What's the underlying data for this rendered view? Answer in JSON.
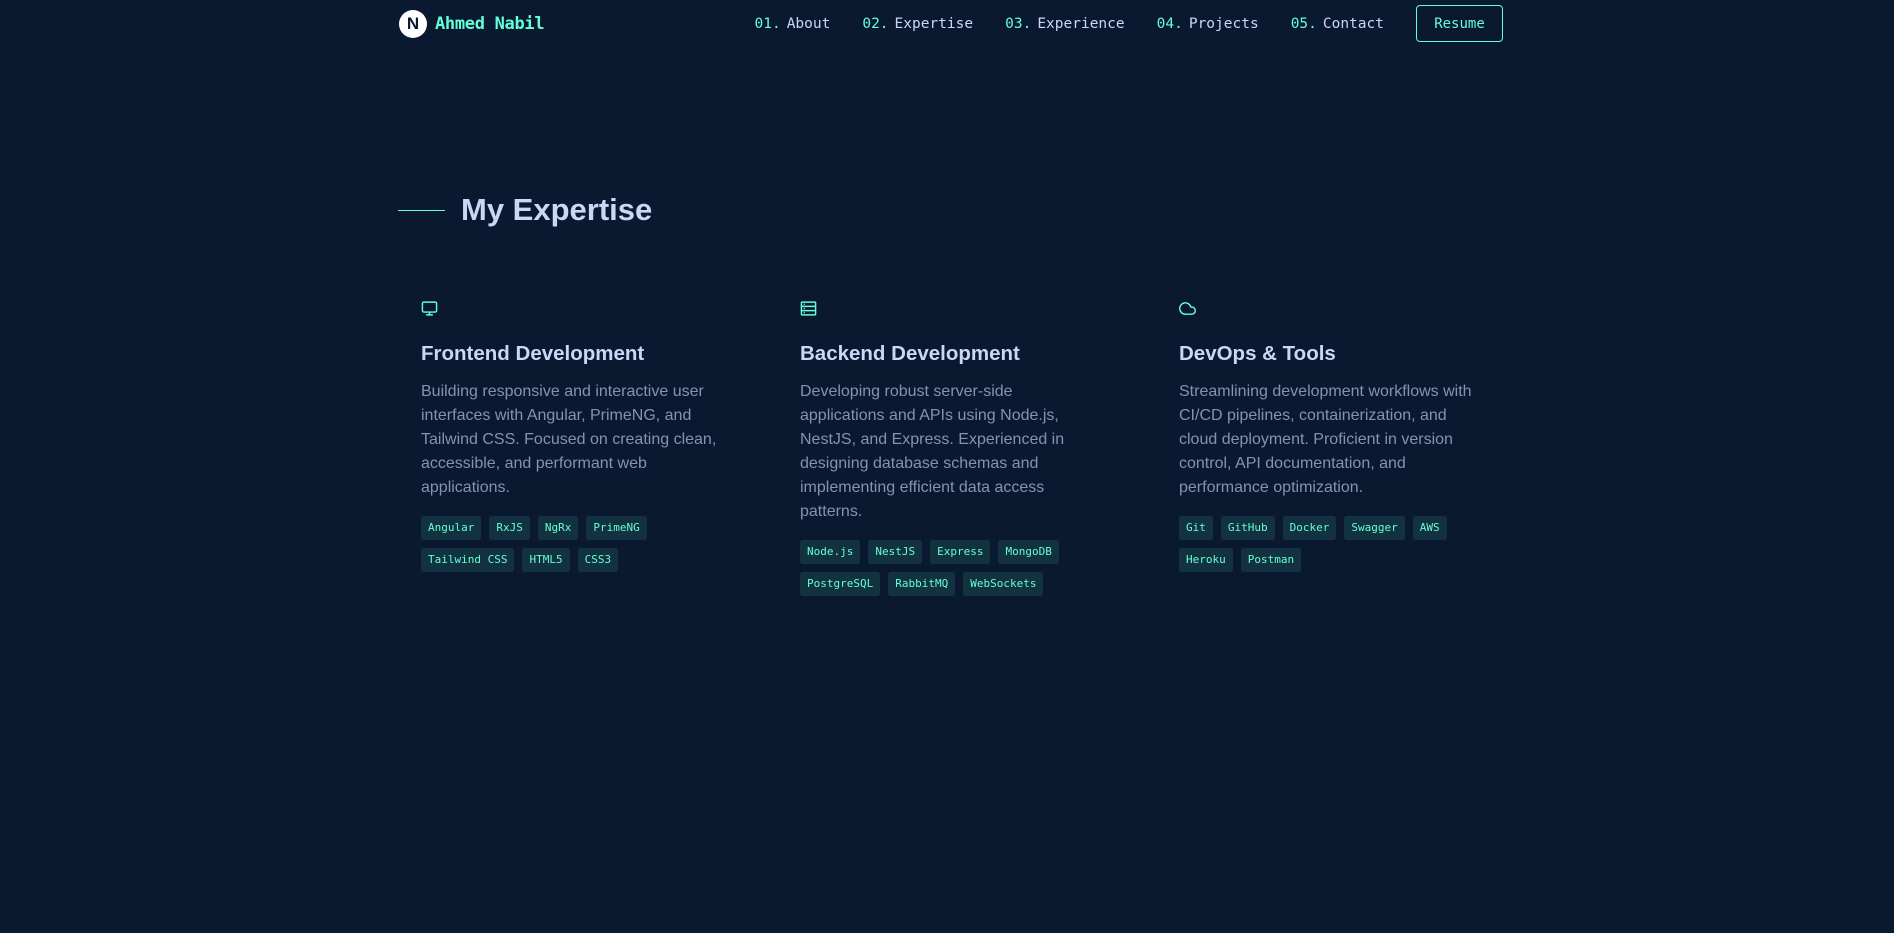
{
  "brand": {
    "logo_letter": "N",
    "name": "Ahmed Nabil"
  },
  "nav": {
    "items": [
      {
        "num": "01.",
        "label": "About"
      },
      {
        "num": "02.",
        "label": "Expertise"
      },
      {
        "num": "03.",
        "label": "Experience"
      },
      {
        "num": "04.",
        "label": "Projects"
      },
      {
        "num": "05.",
        "label": "Contact"
      }
    ],
    "resume_label": "Resume"
  },
  "section": {
    "title": "My Expertise"
  },
  "cards": [
    {
      "icon": "monitor-icon",
      "title": "Frontend Development",
      "description": "Building responsive and interactive user interfaces with Angular, PrimeNG, and Tailwind CSS. Focused on creating clean, accessible, and performant web applications.",
      "tags": [
        "Angular",
        "RxJS",
        "NgRx",
        "PrimeNG",
        "Tailwind CSS",
        "HTML5",
        "CSS3"
      ]
    },
    {
      "icon": "server-icon",
      "title": "Backend Development",
      "description": "Developing robust server-side applications and APIs using Node.js, NestJS, and Express. Experienced in designing database schemas and implementing efficient data access patterns.",
      "tags": [
        "Node.js",
        "NestJS",
        "Express",
        "MongoDB",
        "PostgreSQL",
        "RabbitMQ",
        "WebSockets"
      ]
    },
    {
      "icon": "cloud-icon",
      "title": "DevOps & Tools",
      "description": "Streamlining development workflows with CI/CD pipelines, containerization, and cloud deployment. Proficient in version control, API documentation, and performance optimization.",
      "tags": [
        "Git",
        "GitHub",
        "Docker",
        "Swagger",
        "AWS",
        "Heroku",
        "Postman"
      ]
    }
  ],
  "colors": {
    "background": "#0a192f",
    "accent": "#64ffda",
    "heading": "#ccd6f6",
    "body_text": "#8892b0",
    "tag_background": "#133240"
  }
}
